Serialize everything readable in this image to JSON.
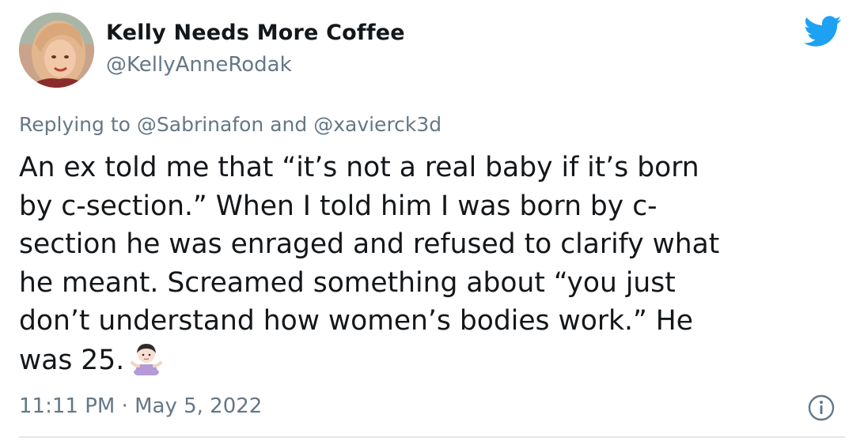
{
  "author": {
    "display_name": "Kelly Needs More Coffee",
    "handle": "@KellyAnneRodak"
  },
  "reply_to": {
    "text": "Replying to @Sabrinafon and @xavierck3d"
  },
  "tweet": {
    "lines": [
      "An ex told me that “it’s not a real baby if it’s born",
      "by c-section.” When I told him I was born by c-",
      "section he was enraged and refused to clarify what",
      "he meant. Screamed something about “you just",
      "don’t understand how women’s bodies work.” He",
      "was 25."
    ],
    "emoji": "person-shrugging-emoji"
  },
  "meta": {
    "timestamp": "11:11 PM · May 5, 2022"
  },
  "colors": {
    "text": "#14171a",
    "secondary": "#657786",
    "twitter_blue": "#1da1f2",
    "divider": "#e1e8ed"
  },
  "icons": {
    "brand": "twitter-bird-icon",
    "info": "info-icon"
  }
}
